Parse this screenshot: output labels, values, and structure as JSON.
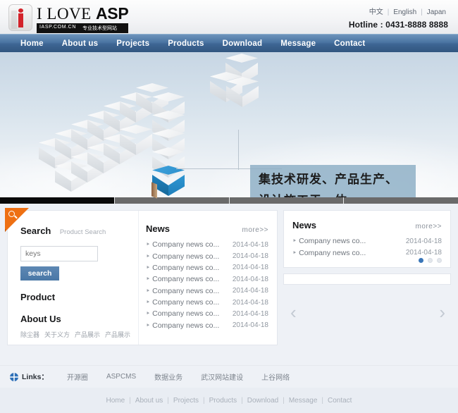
{
  "header": {
    "logo": {
      "word1": "I LOVE",
      "word2": "ASP",
      "domain": "IASP.COM.CN",
      "tagline": "专业技术型网站"
    },
    "languages": [
      {
        "label": "中文"
      },
      {
        "label": "English"
      },
      {
        "label": "Japan"
      }
    ],
    "hotline": "Hotline : 0431-8888 8888"
  },
  "nav": {
    "items": [
      {
        "label": "Home"
      },
      {
        "label": "About us"
      },
      {
        "label": "Projects"
      },
      {
        "label": "Products"
      },
      {
        "label": "Download"
      },
      {
        "label": "Message"
      },
      {
        "label": "Contact"
      }
    ]
  },
  "hero": {
    "caption_line1": "集技术研发、产品生产、",
    "caption_line2": "设计施工于一体……",
    "slider": {
      "total": 4,
      "active": 1
    }
  },
  "search": {
    "title": "Search",
    "subtitle": "Product Search",
    "input_value": "",
    "input_placeholder": "keys",
    "button_label": "search"
  },
  "product": {
    "title": "Product"
  },
  "about": {
    "title": "About Us",
    "links": [
      {
        "label": "除尘器"
      },
      {
        "label": "关于义方"
      },
      {
        "label": "产品展示"
      },
      {
        "label": "产品展示"
      }
    ]
  },
  "news_center": {
    "title": "News",
    "more_label": "more>>",
    "items": [
      {
        "title": "Company news co...",
        "date": "2014-04-18"
      },
      {
        "title": "Company news co...",
        "date": "2014-04-18"
      },
      {
        "title": "Company news co...",
        "date": "2014-04-18"
      },
      {
        "title": "Company news co...",
        "date": "2014-04-18"
      },
      {
        "title": "Company news co...",
        "date": "2014-04-18"
      },
      {
        "title": "Company news co...",
        "date": "2014-04-18"
      },
      {
        "title": "Company news co...",
        "date": "2014-04-18"
      },
      {
        "title": "Company news co...",
        "date": "2014-04-18"
      }
    ]
  },
  "news_right": {
    "title": "News",
    "more_label": "more>>",
    "items": [
      {
        "title": "Company news co...",
        "date": "2014-04-18"
      },
      {
        "title": "Company news co...",
        "date": "2014-04-18"
      }
    ],
    "dots": {
      "total": 3,
      "active": 1
    }
  },
  "carousel": {
    "prev_label": "‹",
    "next_label": "›"
  },
  "links_bar": {
    "label": "Links：",
    "items": [
      {
        "label": "开源圈"
      },
      {
        "label": "ASPCMS"
      },
      {
        "label": "数据业务"
      },
      {
        "label": "武汉网站建设"
      },
      {
        "label": "上谷网络"
      }
    ]
  },
  "footer": {
    "items": [
      {
        "label": "Home"
      },
      {
        "label": "About us"
      },
      {
        "label": "Projects"
      },
      {
        "label": "Products"
      },
      {
        "label": "Download"
      },
      {
        "label": "Message"
      },
      {
        "label": "Contact"
      }
    ],
    "separator": "|"
  },
  "colors": {
    "nav_blue": "#3d6593",
    "accent_orange": "#ee7013",
    "logo_red": "#d3232a",
    "button_blue": "#4a77a6",
    "caption_bg": "#8badc5"
  }
}
